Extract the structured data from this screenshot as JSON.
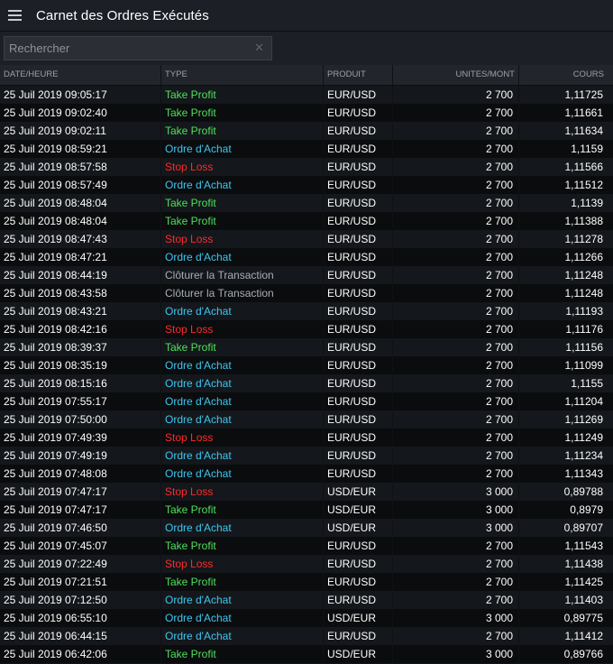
{
  "app": {
    "title": "Carnet des Ordres Exécutés",
    "menu_icon": "hamburger-menu-icon"
  },
  "search": {
    "placeholder": "Rechercher",
    "value": "",
    "clear_icon": "close-icon"
  },
  "colors": {
    "take_profit": "#4fe05a",
    "ordre_achat": "#3ec6f0",
    "stop_loss": "#ff2b2b",
    "cloturer": "#a9aeb5"
  },
  "table": {
    "columns": [
      "DATE/HEURE",
      "TYPE",
      "PRODUIT",
      "UNITES/MONT",
      "COURS"
    ],
    "rows": [
      {
        "date": "25 Juil 2019 09:05:17",
        "type": "Take Profit",
        "kind": "take_profit",
        "product": "EUR/USD",
        "units": "2 700",
        "cours": "1,11725"
      },
      {
        "date": "25 Juil 2019 09:02:40",
        "type": "Take Profit",
        "kind": "take_profit",
        "product": "EUR/USD",
        "units": "2 700",
        "cours": "1,11661"
      },
      {
        "date": "25 Juil 2019 09:02:11",
        "type": "Take Profit",
        "kind": "take_profit",
        "product": "EUR/USD",
        "units": "2 700",
        "cours": "1,11634"
      },
      {
        "date": "25 Juil 2019 08:59:21",
        "type": "Ordre d'Achat",
        "kind": "ordre_achat",
        "product": "EUR/USD",
        "units": "2 700",
        "cours": "1,1159"
      },
      {
        "date": "25 Juil 2019 08:57:58",
        "type": "Stop Loss",
        "kind": "stop_loss",
        "product": "EUR/USD",
        "units": "2 700",
        "cours": "1,11566"
      },
      {
        "date": "25 Juil 2019 08:57:49",
        "type": "Ordre d'Achat",
        "kind": "ordre_achat",
        "product": "EUR/USD",
        "units": "2 700",
        "cours": "1,11512"
      },
      {
        "date": "25 Juil 2019 08:48:04",
        "type": "Take Profit",
        "kind": "take_profit",
        "product": "EUR/USD",
        "units": "2 700",
        "cours": "1,1139"
      },
      {
        "date": "25 Juil 2019 08:48:04",
        "type": "Take Profit",
        "kind": "take_profit",
        "product": "EUR/USD",
        "units": "2 700",
        "cours": "1,11388"
      },
      {
        "date": "25 Juil 2019 08:47:43",
        "type": "Stop Loss",
        "kind": "stop_loss",
        "product": "EUR/USD",
        "units": "2 700",
        "cours": "1,11278"
      },
      {
        "date": "25 Juil 2019 08:47:21",
        "type": "Ordre d'Achat",
        "kind": "ordre_achat",
        "product": "EUR/USD",
        "units": "2 700",
        "cours": "1,11266"
      },
      {
        "date": "25 Juil 2019 08:44:19",
        "type": "Clôturer la Transaction",
        "kind": "cloturer",
        "product": "EUR/USD",
        "units": "2 700",
        "cours": "1,11248"
      },
      {
        "date": "25 Juil 2019 08:43:58",
        "type": "Clôturer la Transaction",
        "kind": "cloturer",
        "product": "EUR/USD",
        "units": "2 700",
        "cours": "1,11248"
      },
      {
        "date": "25 Juil 2019 08:43:21",
        "type": "Ordre d'Achat",
        "kind": "ordre_achat",
        "product": "EUR/USD",
        "units": "2 700",
        "cours": "1,11193"
      },
      {
        "date": "25 Juil 2019 08:42:16",
        "type": "Stop Loss",
        "kind": "stop_loss",
        "product": "EUR/USD",
        "units": "2 700",
        "cours": "1,11176"
      },
      {
        "date": "25 Juil 2019 08:39:37",
        "type": "Take Profit",
        "kind": "take_profit",
        "product": "EUR/USD",
        "units": "2 700",
        "cours": "1,11156"
      },
      {
        "date": "25 Juil 2019 08:35:19",
        "type": "Ordre d'Achat",
        "kind": "ordre_achat",
        "product": "EUR/USD",
        "units": "2 700",
        "cours": "1,11099"
      },
      {
        "date": "25 Juil 2019 08:15:16",
        "type": "Ordre d'Achat",
        "kind": "ordre_achat",
        "product": "EUR/USD",
        "units": "2 700",
        "cours": "1,1155"
      },
      {
        "date": "25 Juil 2019 07:55:17",
        "type": "Ordre d'Achat",
        "kind": "ordre_achat",
        "product": "EUR/USD",
        "units": "2 700",
        "cours": "1,11204"
      },
      {
        "date": "25 Juil 2019 07:50:00",
        "type": "Ordre d'Achat",
        "kind": "ordre_achat",
        "product": "EUR/USD",
        "units": "2 700",
        "cours": "1,11269"
      },
      {
        "date": "25 Juil 2019 07:49:39",
        "type": "Stop Loss",
        "kind": "stop_loss",
        "product": "EUR/USD",
        "units": "2 700",
        "cours": "1,11249"
      },
      {
        "date": "25 Juil 2019 07:49:19",
        "type": "Ordre d'Achat",
        "kind": "ordre_achat",
        "product": "EUR/USD",
        "units": "2 700",
        "cours": "1,11234"
      },
      {
        "date": "25 Juil 2019 07:48:08",
        "type": "Ordre d'Achat",
        "kind": "ordre_achat",
        "product": "EUR/USD",
        "units": "2 700",
        "cours": "1,11343"
      },
      {
        "date": "25 Juil 2019 07:47:17",
        "type": "Stop Loss",
        "kind": "stop_loss",
        "product": "USD/EUR",
        "units": "3 000",
        "cours": "0,89788"
      },
      {
        "date": "25 Juil 2019 07:47:17",
        "type": "Take Profit",
        "kind": "take_profit",
        "product": "USD/EUR",
        "units": "3 000",
        "cours": "0,8979"
      },
      {
        "date": "25 Juil 2019 07:46:50",
        "type": "Ordre d'Achat",
        "kind": "ordre_achat",
        "product": "USD/EUR",
        "units": "3 000",
        "cours": "0,89707"
      },
      {
        "date": "25 Juil 2019 07:45:07",
        "type": "Take Profit",
        "kind": "take_profit",
        "product": "EUR/USD",
        "units": "2 700",
        "cours": "1,11543"
      },
      {
        "date": "25 Juil 2019 07:22:49",
        "type": "Stop Loss",
        "kind": "stop_loss",
        "product": "EUR/USD",
        "units": "2 700",
        "cours": "1,11438"
      },
      {
        "date": "25 Juil 2019 07:21:51",
        "type": "Take Profit",
        "kind": "take_profit",
        "product": "EUR/USD",
        "units": "2 700",
        "cours": "1,11425"
      },
      {
        "date": "25 Juil 2019 07:12:50",
        "type": "Ordre d'Achat",
        "kind": "ordre_achat",
        "product": "EUR/USD",
        "units": "2 700",
        "cours": "1,11403"
      },
      {
        "date": "25 Juil 2019 06:55:10",
        "type": "Ordre d'Achat",
        "kind": "ordre_achat",
        "product": "USD/EUR",
        "units": "3 000",
        "cours": "0,89775"
      },
      {
        "date": "25 Juil 2019 06:44:15",
        "type": "Ordre d'Achat",
        "kind": "ordre_achat",
        "product": "EUR/USD",
        "units": "2 700",
        "cours": "1,11412"
      },
      {
        "date": "25 Juil 2019 06:42:06",
        "type": "Take Profit",
        "kind": "take_profit",
        "product": "USD/EUR",
        "units": "3 000",
        "cours": "0,89766"
      }
    ]
  }
}
